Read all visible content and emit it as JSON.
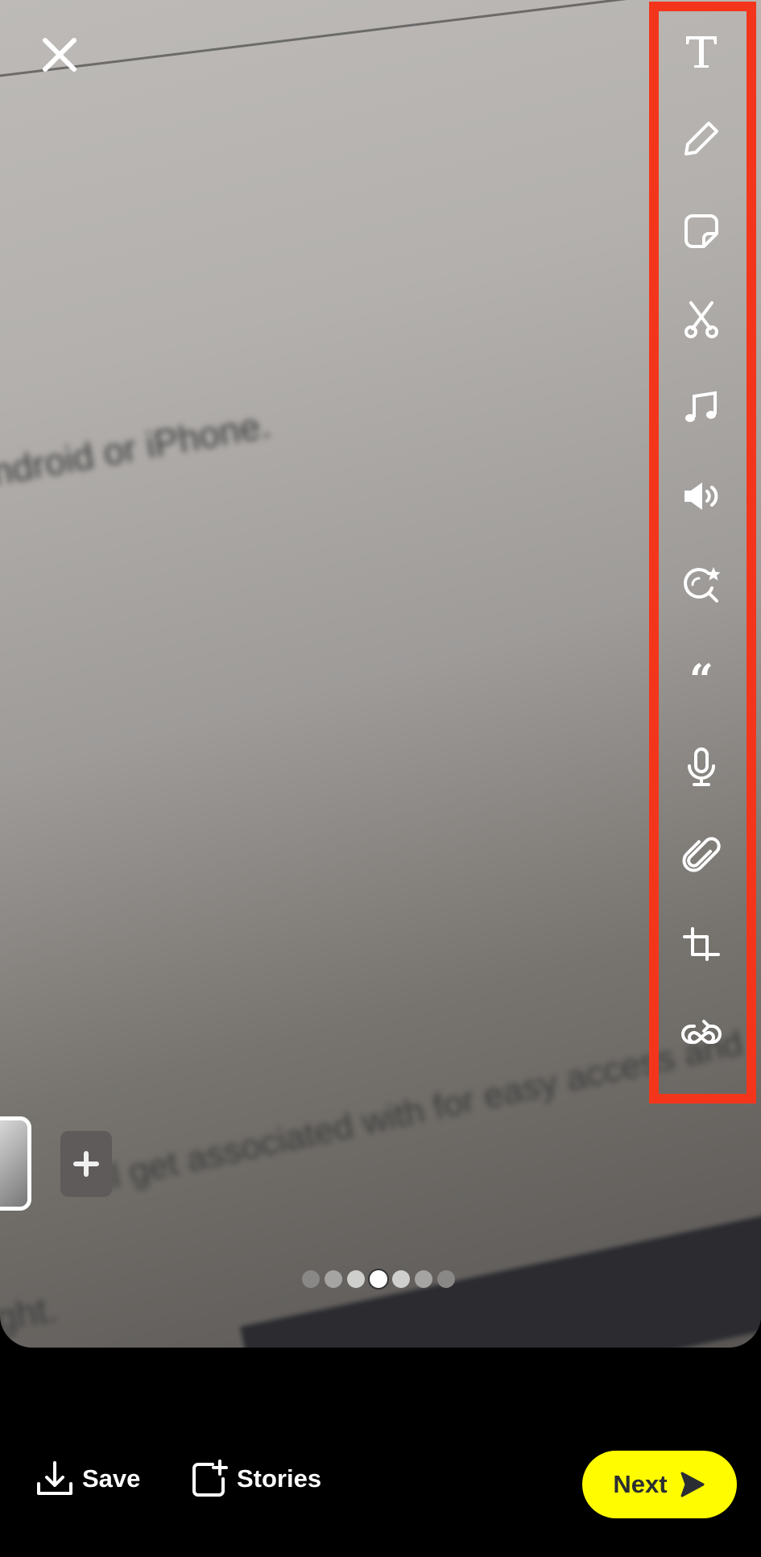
{
  "photo": {
    "blurred_text": [
      "ndroid or iPhone.",
      "ill get associated with for easy access and",
      "ght."
    ]
  },
  "toolbar": {
    "highlight_color": "#f3361b",
    "tools": [
      {
        "name": "text",
        "icon": "text-icon"
      },
      {
        "name": "draw",
        "icon": "pencil-icon"
      },
      {
        "name": "sticker",
        "icon": "sticker-icon"
      },
      {
        "name": "scissors",
        "icon": "scissors-icon"
      },
      {
        "name": "music",
        "icon": "music-note-icon"
      },
      {
        "name": "sound",
        "icon": "speaker-icon"
      },
      {
        "name": "lens",
        "icon": "lens-search-star-icon"
      },
      {
        "name": "quote",
        "icon": "quote-icon"
      },
      {
        "name": "voice",
        "icon": "microphone-icon"
      },
      {
        "name": "link",
        "icon": "paperclip-icon"
      },
      {
        "name": "crop",
        "icon": "crop-icon"
      },
      {
        "name": "loop",
        "icon": "loop-icon"
      }
    ]
  },
  "pager": {
    "count": 7,
    "active": 4
  },
  "bottom": {
    "save_label": "Save",
    "stories_label": "Stories",
    "next_label": "Next",
    "next_color": "#fffc00"
  }
}
